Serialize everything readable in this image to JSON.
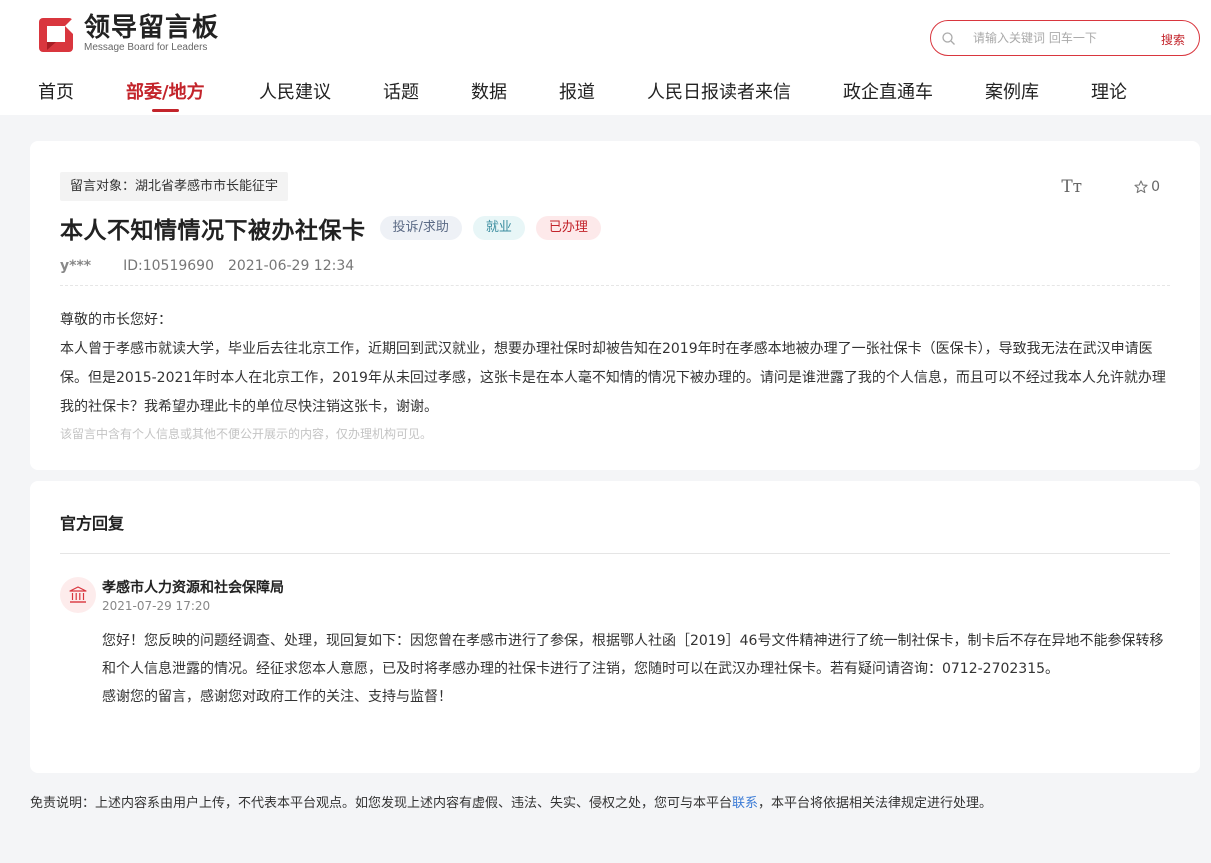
{
  "header": {
    "logo_title": "领导留言板",
    "logo_subtitle": "Message Board for Leaders",
    "brand_color": "#c3242b",
    "search": {
      "placeholder": "请输入关键词 回车一下",
      "button_label": "搜索"
    }
  },
  "nav": {
    "items": [
      {
        "label": "首页"
      },
      {
        "label": "部委/地方",
        "active": true
      },
      {
        "label": "人民建议"
      },
      {
        "label": "话题"
      },
      {
        "label": "数据"
      },
      {
        "label": "报道"
      },
      {
        "label": "人民日报读者来信"
      },
      {
        "label": "政企直通车"
      },
      {
        "label": "案例库"
      },
      {
        "label": "理论"
      }
    ]
  },
  "message": {
    "target": "留言对象：湖北省孝感市市长能征宇",
    "star_count": "0",
    "title": "本人不知情情况下被办社保卡",
    "badges": {
      "type": "投诉/求助",
      "field": "就业",
      "status": "已办理"
    },
    "author": "y***",
    "id": "ID:10519690",
    "datetime": "2021-06-29 12:34",
    "greeting": "尊敬的市长您好：",
    "body": "本人曾于孝感市就读大学，毕业后去往北京工作，近期回到武汉就业，想要办理社保时却被告知在2019年时在孝感本地被办理了一张社保卡（医保卡），导致我无法在武汉申请医保。但是2015-2021年时本人在北京工作，2019年从未回过孝感，这张卡是在本人毫不知情的情况下被办理的。请问是谁泄露了我的个人信息，而且可以不经过我本人允许就办理我的社保卡？我希望办理此卡的单位尽快注销这张卡，谢谢。",
    "privacy_notice": "该留言中含有个人信息或其他不便公开展示的内容，仅办理机构可见。"
  },
  "reply": {
    "section_title": "官方回复",
    "org_name": "孝感市人力资源和社会保障局",
    "datetime": "2021-07-29 17:20",
    "body": "您好！您反映的问题经调查、处理，现回复如下：因您曾在孝感市进行了参保，根据鄂人社函［2019］46号文件精神进行了统一制社保卡，制卡后不存在异地不能参保转移和个人信息泄露的情况。经征求您本人意愿，已及时将孝感办理的社保卡进行了注销，您随时可以在武汉办理社保卡。若有疑问请咨询：0712-2702315。",
    "closing": "感谢您的留言，感谢您对政府工作的关注、支持与监督！"
  },
  "footer": {
    "disclaimer_prefix": "免责说明：上述内容系由用户上传，不代表本平台观点。如您发现上述内容有虚假、违法、失实、侵权之处，您可与本平台",
    "disclaimer_link": "联系",
    "disclaimer_suffix": "，本平台将依据相关法律规定进行处理。"
  }
}
